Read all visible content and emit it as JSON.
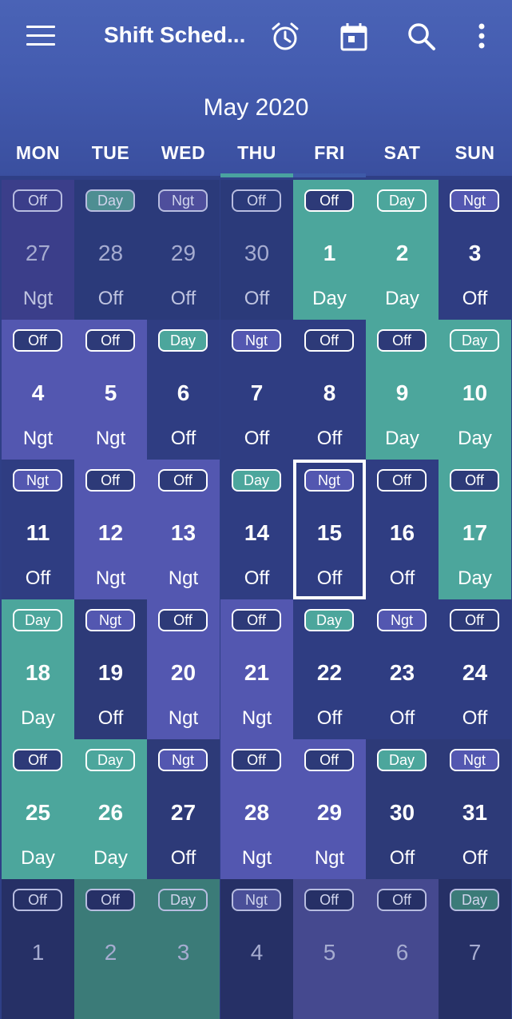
{
  "app": {
    "title": "Shift Sched...",
    "month_label": "May 2020"
  },
  "toolbar": {
    "icons": [
      "menu-icon",
      "alarm-clock-icon",
      "calendar-icon",
      "search-icon",
      "more-vert-icon"
    ]
  },
  "weekdays": [
    "MON",
    "TUE",
    "WED",
    "THU",
    "FRI",
    "SAT",
    "SUN"
  ],
  "colors": {
    "off_dark": "#2d3a78",
    "off_dim": "#3a4389",
    "ngt": "#5357b0",
    "day": "#4ca69c",
    "day_dark": "#3e7f86",
    "header": "#445cb0"
  },
  "weeks": [
    [
      {
        "date": "27",
        "badge": "Off",
        "label": "Ngt",
        "bg": "#3b3e8a",
        "badge_bg": "transparent",
        "dim": true
      },
      {
        "date": "28",
        "badge": "Day",
        "label": "Off",
        "bg": "#2b3a7a",
        "badge_bg": "#4e8e92",
        "dim": true
      },
      {
        "date": "29",
        "badge": "Ngt",
        "label": "Off",
        "bg": "#2b3a7a",
        "badge_bg": "#4e4e9c",
        "dim": true
      },
      {
        "date": "30",
        "badge": "Off",
        "label": "Off",
        "bg": "#2b3a7a",
        "badge_bg": "transparent",
        "dim": true
      },
      {
        "date": "1",
        "badge": "Off",
        "label": "Day",
        "bg": "#4ca69c",
        "badge_bg": "#2d3a78",
        "dim": false
      },
      {
        "date": "2",
        "badge": "Day",
        "label": "Day",
        "bg": "#4ca69c",
        "badge_bg": "#4ca69c",
        "dim": false
      },
      {
        "date": "3",
        "badge": "Ngt",
        "label": "Off",
        "bg": "#2f3d82",
        "badge_bg": "#5357b0",
        "dim": false
      }
    ],
    [
      {
        "date": "4",
        "badge": "Off",
        "label": "Ngt",
        "bg": "#5357b0",
        "badge_bg": "#2d3a78",
        "dim": false
      },
      {
        "date": "5",
        "badge": "Off",
        "label": "Ngt",
        "bg": "#5357b0",
        "badge_bg": "#2d3a78",
        "dim": false
      },
      {
        "date": "6",
        "badge": "Day",
        "label": "Off",
        "bg": "#2f3d82",
        "badge_bg": "#4ca69c",
        "dim": false
      },
      {
        "date": "7",
        "badge": "Ngt",
        "label": "Off",
        "bg": "#2f3d82",
        "badge_bg": "#5357b0",
        "dim": false
      },
      {
        "date": "8",
        "badge": "Off",
        "label": "Off",
        "bg": "#2f3d82",
        "badge_bg": "#2d3a78",
        "dim": false
      },
      {
        "date": "9",
        "badge": "Off",
        "label": "Day",
        "bg": "#4ca69c",
        "badge_bg": "#2d3a78",
        "dim": false
      },
      {
        "date": "10",
        "badge": "Day",
        "label": "Day",
        "bg": "#4ca69c",
        "badge_bg": "#4ca69c",
        "dim": false
      }
    ],
    [
      {
        "date": "11",
        "badge": "Ngt",
        "label": "Off",
        "bg": "#2f3d82",
        "badge_bg": "#5357b0",
        "dim": false
      },
      {
        "date": "12",
        "badge": "Off",
        "label": "Ngt",
        "bg": "#5357b0",
        "badge_bg": "#2d3a78",
        "dim": false
      },
      {
        "date": "13",
        "badge": "Off",
        "label": "Ngt",
        "bg": "#5357b0",
        "badge_bg": "#2d3a78",
        "dim": false
      },
      {
        "date": "14",
        "badge": "Day",
        "label": "Off",
        "bg": "#2f3d82",
        "badge_bg": "#4ca69c",
        "dim": false
      },
      {
        "date": "15",
        "badge": "Ngt",
        "label": "Off",
        "bg": "#2f3d82",
        "badge_bg": "#5357b0",
        "dim": false,
        "today": true
      },
      {
        "date": "16",
        "badge": "Off",
        "label": "Off",
        "bg": "#2f3d82",
        "badge_bg": "#2d3a78",
        "dim": false
      },
      {
        "date": "17",
        "badge": "Off",
        "label": "Day",
        "bg": "#4ca69c",
        "badge_bg": "#2d3a78",
        "dim": false
      }
    ],
    [
      {
        "date": "18",
        "badge": "Day",
        "label": "Day",
        "bg": "#4ca69c",
        "badge_bg": "#4ca69c",
        "dim": false
      },
      {
        "date": "19",
        "badge": "Ngt",
        "label": "Off",
        "bg": "#2d3a78",
        "badge_bg": "#5357b0",
        "dim": false
      },
      {
        "date": "20",
        "badge": "Off",
        "label": "Ngt",
        "bg": "#5357b0",
        "badge_bg": "#2d3a78",
        "dim": false
      },
      {
        "date": "21",
        "badge": "Off",
        "label": "Ngt",
        "bg": "#5357b0",
        "badge_bg": "#2d3a78",
        "dim": false
      },
      {
        "date": "22",
        "badge": "Day",
        "label": "Off",
        "bg": "#2f3d82",
        "badge_bg": "#4ca69c",
        "dim": false
      },
      {
        "date": "23",
        "badge": "Ngt",
        "label": "Off",
        "bg": "#2f3d82",
        "badge_bg": "#5357b0",
        "dim": false
      },
      {
        "date": "24",
        "badge": "Off",
        "label": "Off",
        "bg": "#2f3d82",
        "badge_bg": "#2d3a78",
        "dim": false
      }
    ],
    [
      {
        "date": "25",
        "badge": "Off",
        "label": "Day",
        "bg": "#4ca69c",
        "badge_bg": "#2d3a78",
        "dim": false
      },
      {
        "date": "26",
        "badge": "Day",
        "label": "Day",
        "bg": "#4ca69c",
        "badge_bg": "#4ca69c",
        "dim": false
      },
      {
        "date": "27",
        "badge": "Ngt",
        "label": "Off",
        "bg": "#2d3a78",
        "badge_bg": "#5357b0",
        "dim": false
      },
      {
        "date": "28",
        "badge": "Off",
        "label": "Ngt",
        "bg": "#5357b0",
        "badge_bg": "#2d3a78",
        "dim": false
      },
      {
        "date": "29",
        "badge": "Off",
        "label": "Ngt",
        "bg": "#5357b0",
        "badge_bg": "#2d3a78",
        "dim": false
      },
      {
        "date": "30",
        "badge": "Day",
        "label": "Off",
        "bg": "#2d3a78",
        "badge_bg": "#4ca69c",
        "dim": false
      },
      {
        "date": "31",
        "badge": "Ngt",
        "label": "Off",
        "bg": "#2d3a78",
        "badge_bg": "#5357b0",
        "dim": false
      }
    ],
    [
      {
        "date": "1",
        "badge": "Off",
        "label": "",
        "bg": "#263066",
        "badge_bg": "transparent",
        "dim": true
      },
      {
        "date": "2",
        "badge": "Off",
        "label": "",
        "bg": "#3b7b78",
        "badge_bg": "#263066",
        "dim": true
      },
      {
        "date": "3",
        "badge": "Day",
        "label": "",
        "bg": "#3b7b78",
        "badge_bg": "#3b7b78",
        "dim": true
      },
      {
        "date": "4",
        "badge": "Ngt",
        "label": "",
        "bg": "#263066",
        "badge_bg": "#4a4f98",
        "dim": true
      },
      {
        "date": "5",
        "badge": "Off",
        "label": "",
        "bg": "#45498f",
        "badge_bg": "#263066",
        "dim": true
      },
      {
        "date": "6",
        "badge": "Off",
        "label": "",
        "bg": "#45498f",
        "badge_bg": "#263066",
        "dim": true
      },
      {
        "date": "7",
        "badge": "Day",
        "label": "",
        "bg": "#263066",
        "badge_bg": "#3b7b78",
        "dim": true
      }
    ]
  ]
}
